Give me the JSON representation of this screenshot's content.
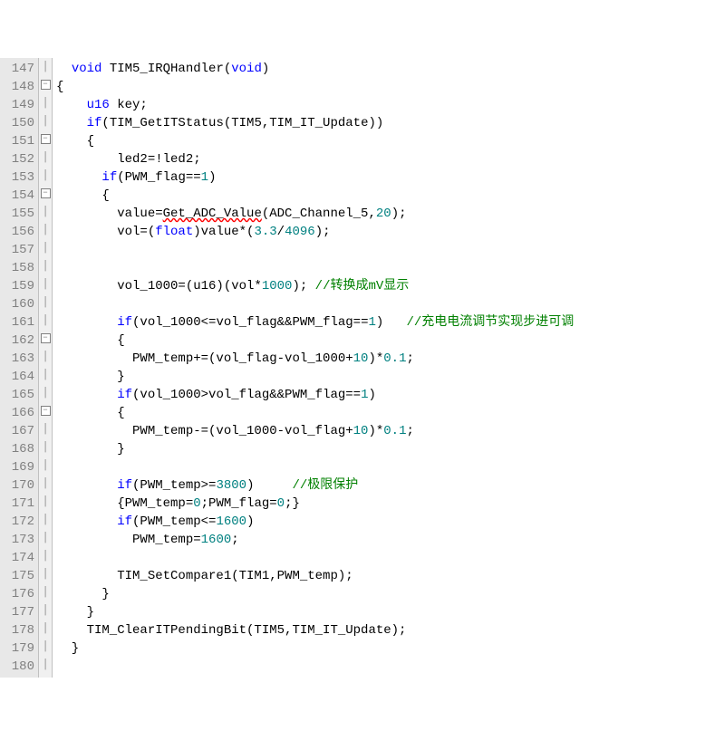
{
  "lines": {
    "start": 147,
    "end": 180
  },
  "fold": {
    "148": "⊟",
    "151": "⊟",
    "154": "⊟",
    "162": "⊟",
    "166": "⊟"
  },
  "code": {
    "l147": {
      "pre": "  ",
      "kw1": "void",
      "mid": " TIM5_IRQHandler(",
      "kw2": "void",
      "post": ")"
    },
    "l148": "{",
    "l149": {
      "pre": "    ",
      "kw": "u16",
      "post": " key;"
    },
    "l150": {
      "pre": "    ",
      "kw": "if",
      "post": "(TIM_GetITStatus(TIM5,TIM_IT_Update))"
    },
    "l151": "    {",
    "l152": "        led2=!led2;",
    "l153": {
      "pre": "      ",
      "kw": "if",
      "mid": "(PWM_flag==",
      "num": "1",
      "post": ")"
    },
    "l154": "      {",
    "l155": {
      "pre": "        value=",
      "err": "Get_ADC_Value",
      "mid": "(ADC_Channel_5,",
      "num": "20",
      "post": ");"
    },
    "l156": {
      "pre": "        vol=(",
      "kw": "float",
      "mid": ")value*(",
      "num1": "3.3",
      "mid2": "/",
      "num2": "4096",
      "post": ");"
    },
    "l157": "",
    "l158": "",
    "l159": {
      "pre": "        vol_1000=(u16)(vol*",
      "num": "1000",
      "mid": "); ",
      "comment": "//转换成mV显示"
    },
    "l160": "",
    "l161": {
      "pre": "        ",
      "kw": "if",
      "mid": "(vol_1000<=vol_flag&&PWM_flag==",
      "num": "1",
      "mid2": ")   ",
      "comment": "//充电电流调节实现步进可调"
    },
    "l162": "        {",
    "l163": {
      "pre": "          PWM_temp+=(vol_flag-vol_1000+",
      "num1": "10",
      "mid": ")*",
      "num2": "0.1",
      "post": ";"
    },
    "l164": "        }",
    "l165": {
      "pre": "        ",
      "kw": "if",
      "mid": "(vol_1000>vol_flag&&PWM_flag==",
      "num": "1",
      "post": ")"
    },
    "l166": "        {",
    "l167": {
      "pre": "          PWM_temp-=(vol_1000-vol_flag+",
      "num1": "10",
      "mid": ")*",
      "num2": "0.1",
      "post": ";"
    },
    "l168": "        }",
    "l169": "",
    "l170": {
      "pre": "        ",
      "kw": "if",
      "mid": "(PWM_temp>=",
      "num": "3800",
      "mid2": ")     ",
      "comment": "//极限保护"
    },
    "l171": {
      "pre": "        {PWM_temp=",
      "num1": "0",
      "mid": ";PWM_flag=",
      "num2": "0",
      "post": ";}"
    },
    "l172": {
      "pre": "        ",
      "kw": "if",
      "mid": "(PWM_temp<=",
      "num": "1600",
      "post": ")"
    },
    "l173": {
      "pre": "          PWM_temp=",
      "num": "1600",
      "post": ";"
    },
    "l174": "",
    "l175": "        TIM_SetCompare1(TIM1,PWM_temp);",
    "l176": "      }",
    "l177": "    }",
    "l178": "    TIM_ClearITPendingBit(TIM5,TIM_IT_Update);",
    "l179": "  }",
    "l180": ""
  }
}
